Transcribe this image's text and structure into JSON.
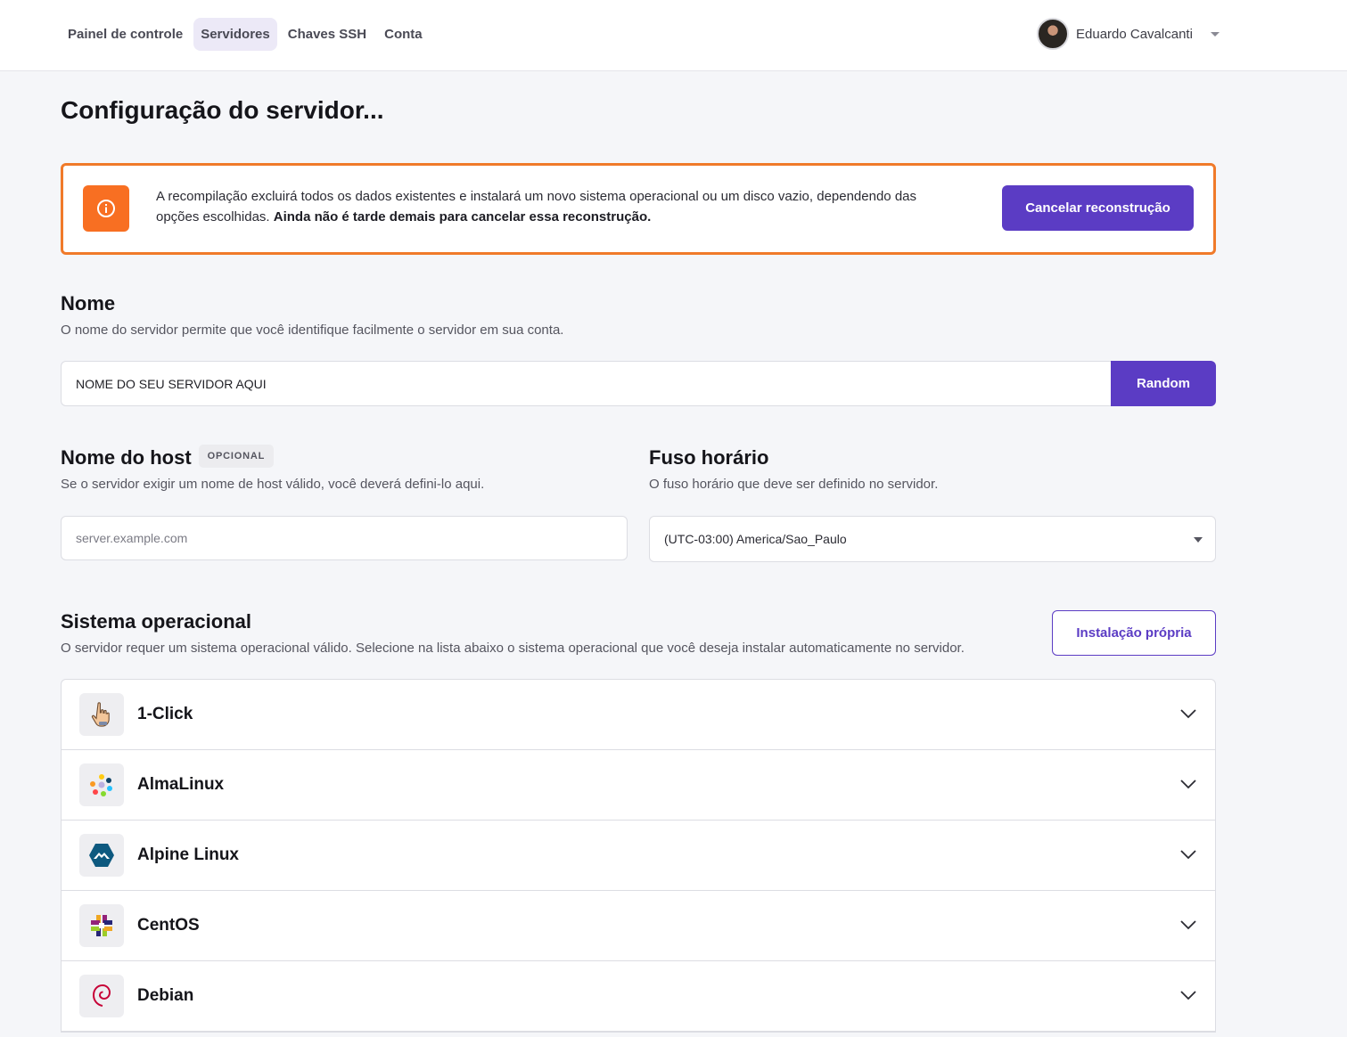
{
  "nav": {
    "items": [
      {
        "label": "Painel de controle",
        "active": false
      },
      {
        "label": "Servidores",
        "active": true
      },
      {
        "label": "Chaves SSH",
        "active": false
      },
      {
        "label": "Conta",
        "active": false
      }
    ]
  },
  "user": {
    "name": "Eduardo Cavalcanti"
  },
  "page": {
    "title": "Configuração do servidor..."
  },
  "warning": {
    "text": "A recompilação excluirá todos os dados existentes e instalará um novo sistema operacional ou um disco vazio, dependendo das opções escolhidas. ",
    "emphasis": "Ainda não é tarde demais para cancelar essa reconstrução.",
    "button": "Cancelar reconstrução",
    "color": "#f07a2a"
  },
  "name_section": {
    "title": "Nome",
    "description": "O nome do servidor permite que você identifique facilmente o servidor em sua conta.",
    "value": "NOME DO SEU SERVIDOR AQUI",
    "random_button": "Random"
  },
  "hostname_section": {
    "title": "Nome do host",
    "badge": "OPCIONAL",
    "description": "Se o servidor exigir um nome de host válido, você deverá defini-lo aqui.",
    "placeholder": "server.example.com"
  },
  "timezone_section": {
    "title": "Fuso horário",
    "description": "O fuso horário que deve ser definido no servidor.",
    "selected": "(UTC-03:00) America/Sao_Paulo"
  },
  "os_section": {
    "title": "Sistema operacional",
    "description": "O servidor requer um sistema operacional válido. Selecione na lista abaixo o sistema operacional que você deseja instalar automaticamente no servidor.",
    "custom_button": "Instalação própria",
    "items": [
      {
        "label": "1-Click",
        "icon": "pointer-hand-icon"
      },
      {
        "label": "AlmaLinux",
        "icon": "almalinux-icon"
      },
      {
        "label": "Alpine Linux",
        "icon": "alpine-linux-icon"
      },
      {
        "label": "CentOS",
        "icon": "centos-icon"
      },
      {
        "label": "Debian",
        "icon": "debian-icon"
      }
    ]
  },
  "colors": {
    "accent": "#5b3cc4",
    "warning": "#f86f22"
  }
}
